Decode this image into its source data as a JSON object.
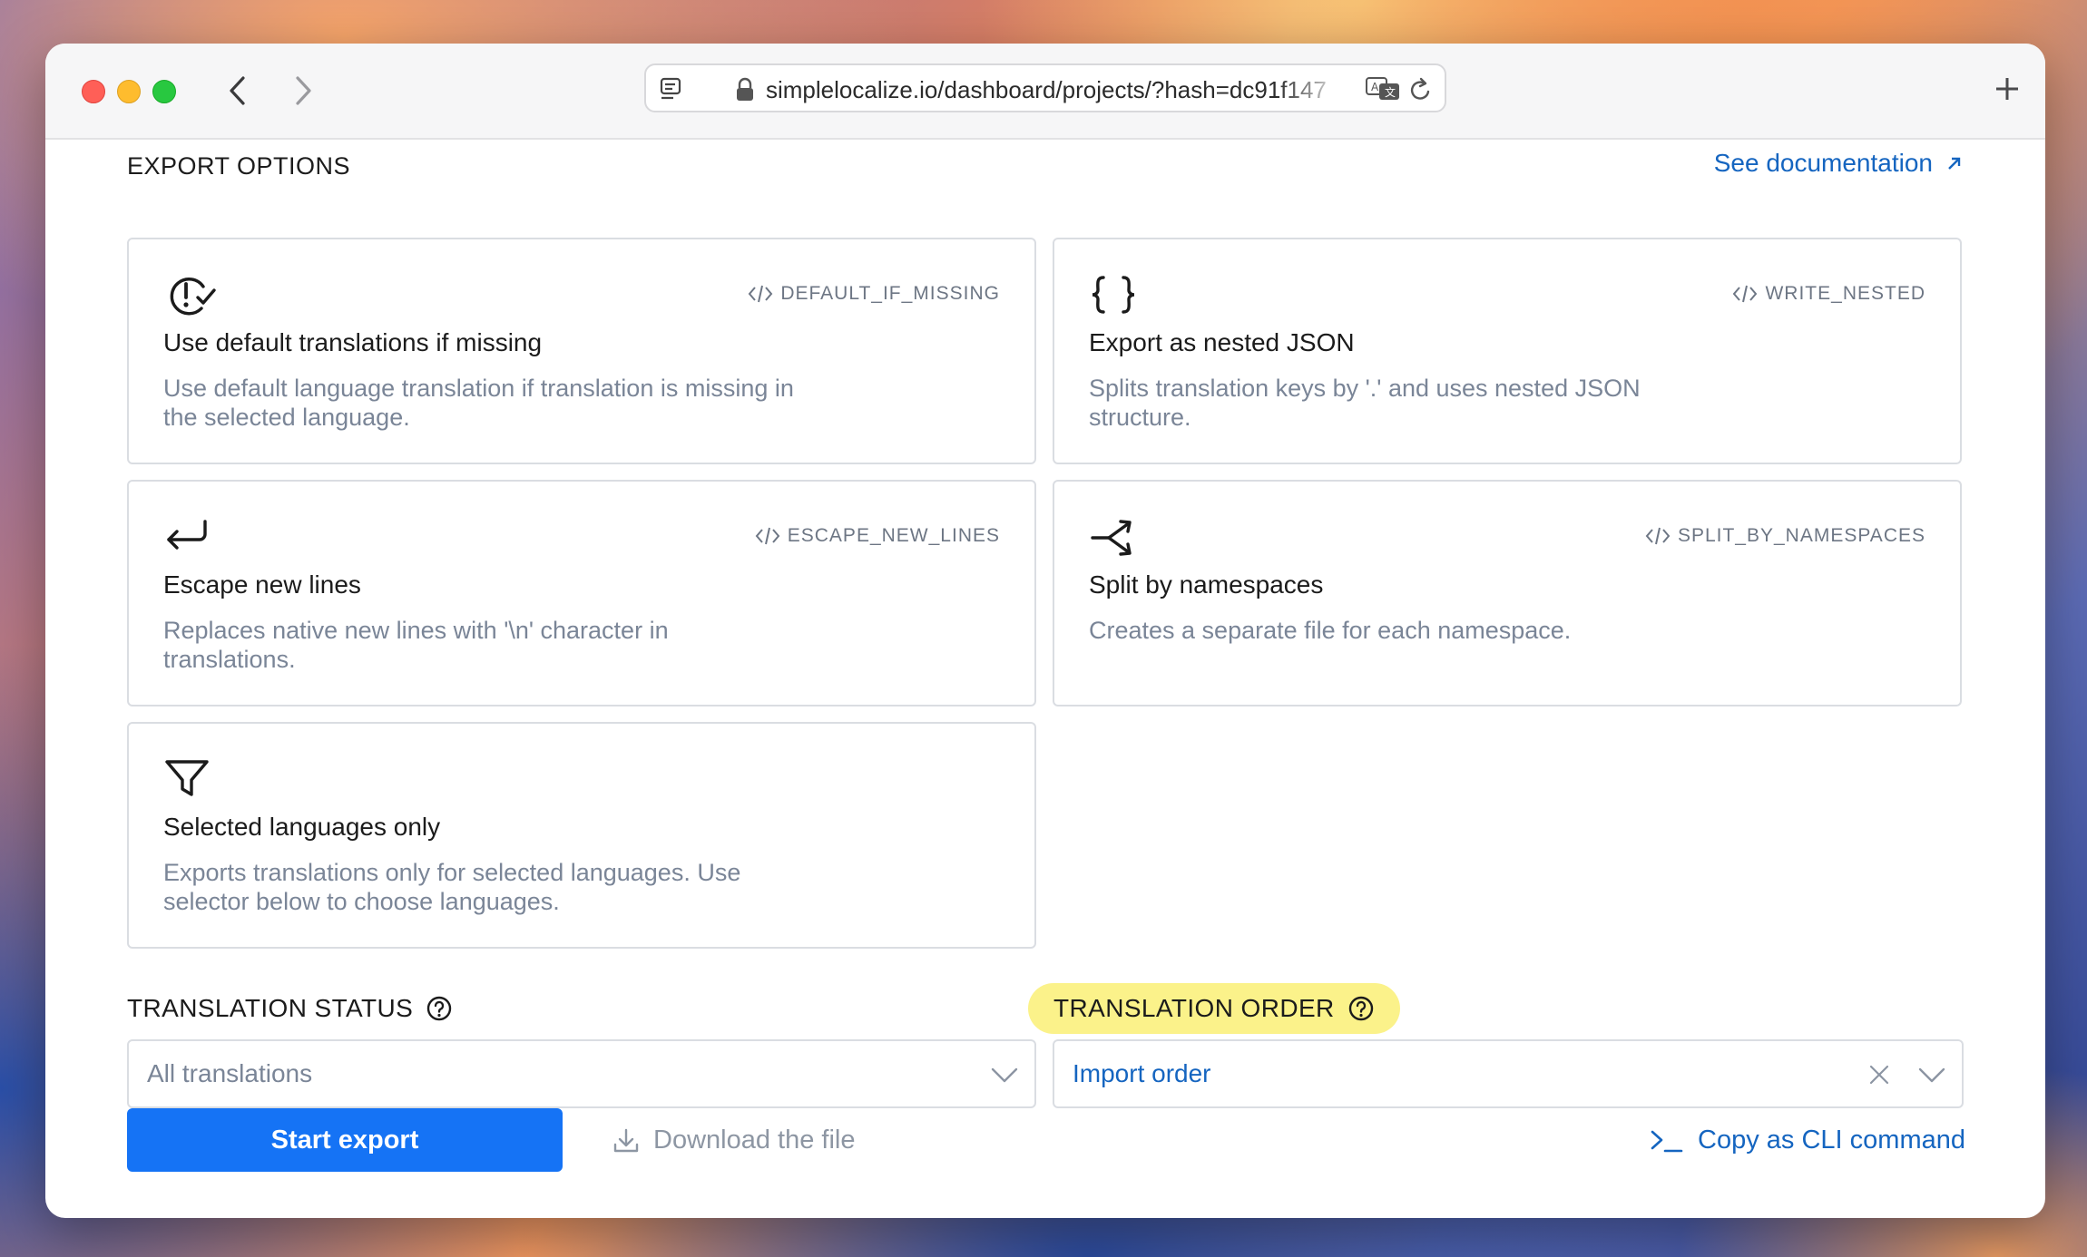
{
  "browser": {
    "url": "simplelocalize.io/dashboard/projects/?hash=dc91f147"
  },
  "export_options": {
    "title": "EXPORT OPTIONS",
    "doc_link": "See documentation",
    "cards": [
      {
        "icon": "alert-check-icon",
        "code": "DEFAULT_IF_MISSING",
        "title": "Use default translations if missing",
        "description": "Use default language translation if translation is missing in the selected language."
      },
      {
        "icon": "braces-icon",
        "code": "WRITE_NESTED",
        "title": "Export as nested JSON",
        "description": "Splits translation keys by '.' and uses nested JSON structure."
      },
      {
        "icon": "return-arrow-icon",
        "code": "ESCAPE_NEW_LINES",
        "title": "Escape new lines",
        "description": "Replaces native new lines with '\\n' character in translations."
      },
      {
        "icon": "split-arrow-icon",
        "code": "SPLIT_BY_NAMESPACES",
        "title": "Split by namespaces",
        "description": "Creates a separate file for each namespace."
      },
      {
        "icon": "filter-icon",
        "code": "",
        "title": "Selected languages only",
        "description": "Exports translations only for selected languages. Use selector below to choose languages."
      }
    ]
  },
  "translation_status": {
    "label": "TRANSLATION STATUS",
    "value": "All translations"
  },
  "translation_order": {
    "label": "TRANSLATION ORDER",
    "value": "Import order"
  },
  "actions": {
    "start_export": "Start export",
    "download": "Download the file",
    "copy_cli": "Copy as CLI command"
  },
  "colors": {
    "accent": "#1573f5",
    "link": "#1565c0",
    "highlight": "#fbf28a"
  }
}
